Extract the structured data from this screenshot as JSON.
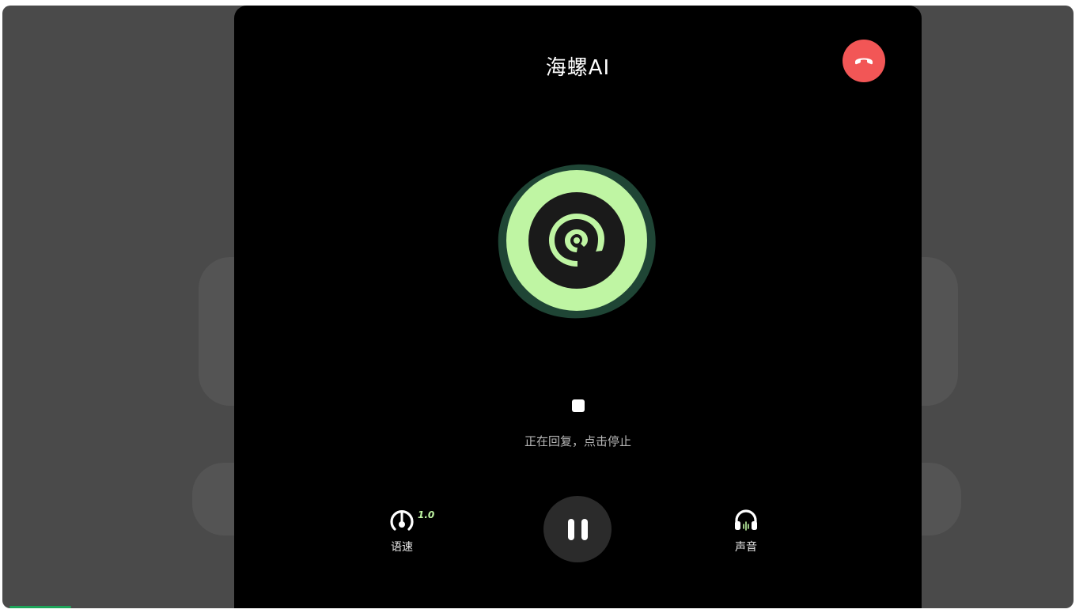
{
  "app": {
    "title": "海螺AI"
  },
  "call": {
    "hangup_icon": "phone-hangup-icon",
    "stop_icon": "stop-square-icon",
    "status_text": "正在回复，点击停止"
  },
  "controls": {
    "speed": {
      "label": "语速",
      "value": "1.0",
      "icon": "speedometer-icon"
    },
    "pause": {
      "icon": "pause-icon"
    },
    "voice": {
      "label": "声音",
      "icon": "headphones-icon"
    }
  },
  "colors": {
    "panel_bg": "#000000",
    "hangup_red": "#f25656",
    "avatar_outer": "#1f4535",
    "avatar_ring": "#bff5a3",
    "accent_green": "#bff5a3"
  }
}
